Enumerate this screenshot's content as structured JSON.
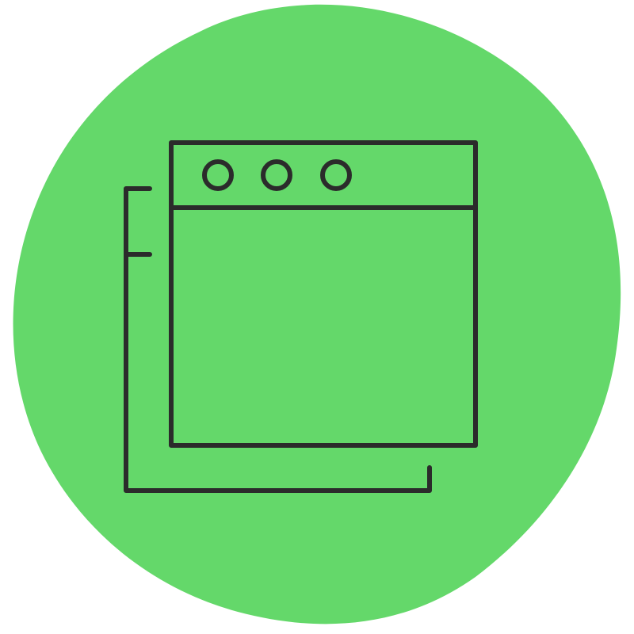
{
  "illustration": {
    "subject": "browser-windows-icon",
    "colors": {
      "background": "#ffffff",
      "blob": "#64d86a",
      "stroke": "#2b2b2b"
    },
    "icons": {
      "backdrop": "blob-shape",
      "front_window": "browser-window-icon",
      "back_window": "stacked-window-outline-icon",
      "window_controls": "window-control-dots-icon"
    }
  }
}
